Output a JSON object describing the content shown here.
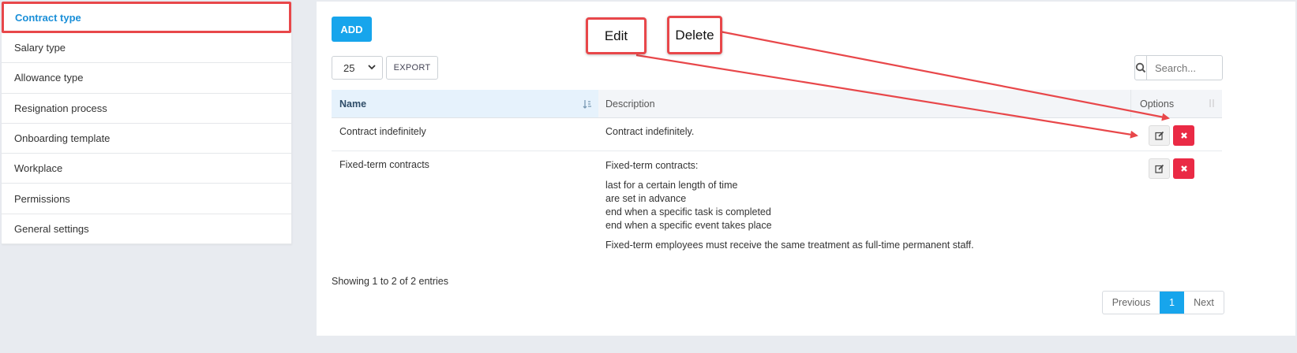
{
  "sidebar": {
    "items": [
      {
        "label": "Contract type"
      },
      {
        "label": "Salary type"
      },
      {
        "label": "Allowance type"
      },
      {
        "label": "Resignation process"
      },
      {
        "label": "Onboarding template"
      },
      {
        "label": "Workplace"
      },
      {
        "label": "Permissions"
      },
      {
        "label": "General settings"
      }
    ]
  },
  "toolbar": {
    "add_label": "ADD",
    "page_length": "25",
    "export_label": "EXPORT",
    "search_placeholder": "Search..."
  },
  "table": {
    "columns": {
      "name": "Name",
      "description": "Description",
      "options": "Options"
    },
    "rows": [
      {
        "name": "Contract indefinitely",
        "description_lines": [
          "Contract indefinitely."
        ]
      },
      {
        "name": "Fixed-term contracts",
        "description_intro": "Fixed-term contracts:",
        "description_list": [
          "last for a certain length of time",
          "are set in advance",
          "end when a specific task is completed",
          "end when a specific event takes place"
        ],
        "description_outro": "Fixed-term employees must receive the same treatment as full-time permanent staff."
      }
    ]
  },
  "footer": {
    "info": "Showing 1 to 2 of 2 entries",
    "pagination": {
      "previous": "Previous",
      "current": "1",
      "next": "Next"
    }
  },
  "annotations": {
    "edit_label": "Edit",
    "delete_label": "Delete",
    "color": "#e8474a"
  },
  "colors": {
    "accent": "#17a5ec",
    "danger": "#ea2a45",
    "active_nav_text": "#1a8fd8"
  }
}
